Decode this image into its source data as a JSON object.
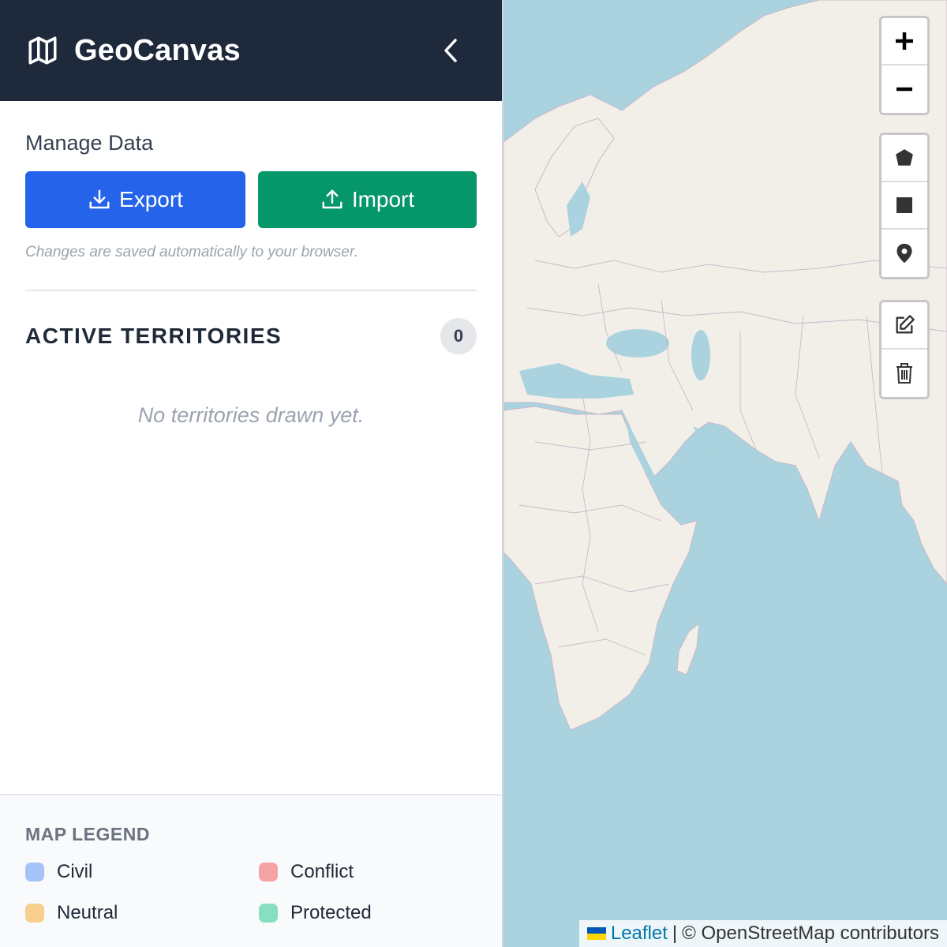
{
  "app": {
    "title": "GeoCanvas"
  },
  "manage": {
    "title": "Manage Data",
    "export_label": "Export",
    "import_label": "Import",
    "autosave_note": "Changes are saved automatically to your browser."
  },
  "territories": {
    "title": "ACTIVE TERRITORIES",
    "count": "0",
    "empty_message": "No territories drawn yet."
  },
  "legend": {
    "title": "MAP LEGEND",
    "items": [
      {
        "label": "Civil",
        "color": "#a5c3f7"
      },
      {
        "label": "Conflict",
        "color": "#f5a3a3"
      },
      {
        "label": "Neutral",
        "color": "#f8cf8c"
      },
      {
        "label": "Protected",
        "color": "#86dfbe"
      }
    ]
  },
  "map": {
    "controls": {
      "zoom": [
        "zoom-in",
        "zoom-out"
      ],
      "draw": [
        "polygon",
        "rectangle",
        "marker"
      ],
      "edit": [
        "edit",
        "delete"
      ]
    },
    "attribution": {
      "leaflet": "Leaflet",
      "separator": "|",
      "credit": "© OpenStreetMap contributors"
    }
  },
  "colors": {
    "header_bg": "#1e293b",
    "export_btn": "#2563eb",
    "import_btn": "#059669",
    "water": "#aad3df",
    "land": "#f2efe9"
  }
}
